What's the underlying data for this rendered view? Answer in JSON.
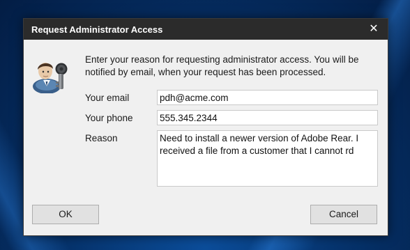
{
  "dialog": {
    "title": "Request Administrator Access",
    "close_glyph": "✕",
    "icon": "administrator-key-icon",
    "intro_text": "Enter your reason for requesting administrator access. You will be notified by email, when your request has been processed."
  },
  "form": {
    "email_label": "Your email",
    "email_value": "pdh@acme.com",
    "phone_label": "Your phone",
    "phone_value": "555.345.2344",
    "reason_label": "Reason",
    "reason_value": "Need to install a newer version of Adobe Rear. I received a file from a customer that I cannot rd"
  },
  "buttons": {
    "ok_label": "OK",
    "cancel_label": "Cancel"
  },
  "colors": {
    "titlebar": "#2b2b2b",
    "dialog_bg": "#f0f0f0",
    "desktop_accent": "#0b4d9a"
  }
}
